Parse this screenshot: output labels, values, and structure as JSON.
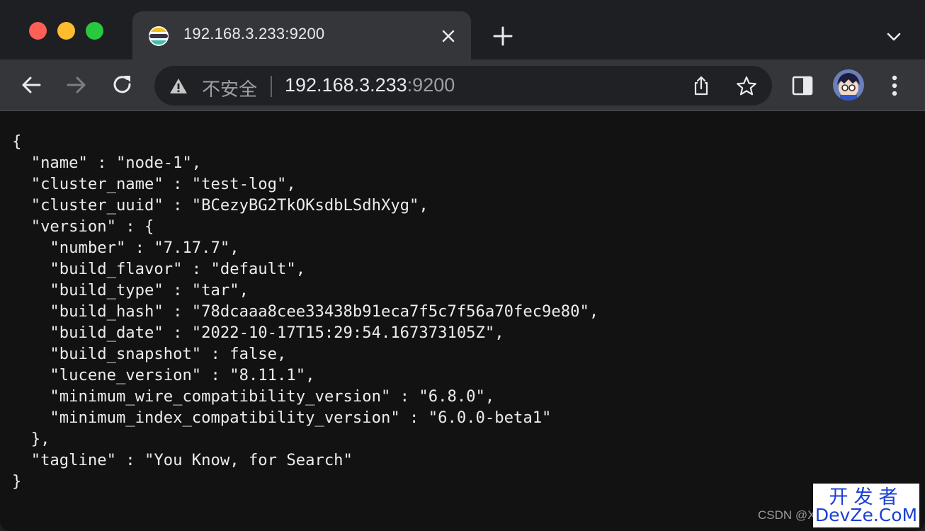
{
  "tab": {
    "title": "192.168.3.233:9200",
    "favicon": "elasticsearch-icon"
  },
  "toolbar": {
    "security_label": "不安全",
    "url_host": "192.168.3.233",
    "url_port": ":9200"
  },
  "colors": {
    "tab_strip": "#1e1f22",
    "toolbar": "#35363a",
    "omnibox": "#202124",
    "page_background": "#121212",
    "text": "#ececec"
  },
  "content": {
    "lines": [
      "{",
      "  \"name\" : \"node-1\",",
      "  \"cluster_name\" : \"test-log\",",
      "  \"cluster_uuid\" : \"BCezyBG2TkOKsdbLSdhXyg\",",
      "  \"version\" : {",
      "    \"number\" : \"7.17.7\",",
      "    \"build_flavor\" : \"default\",",
      "    \"build_type\" : \"tar\",",
      "    \"build_hash\" : \"78dcaaa8cee33438b91eca7f5c7f56a70fec9e80\",",
      "    \"build_date\" : \"2022-10-17T15:29:54.167373105Z\",",
      "    \"build_snapshot\" : false,",
      "    \"lucene_version\" : \"8.11.1\",",
      "    \"minimum_wire_compatibility_version\" : \"6.8.0\",",
      "    \"minimum_index_compatibility_version\" : \"6.0.0-beta1\"",
      "  },",
      "  \"tagline\" : \"You Know, for Search\"",
      "}"
    ]
  },
  "watermark": {
    "csdn": "CSDN @X",
    "line1": "开发者",
    "line2": "DevZe.CoM"
  }
}
